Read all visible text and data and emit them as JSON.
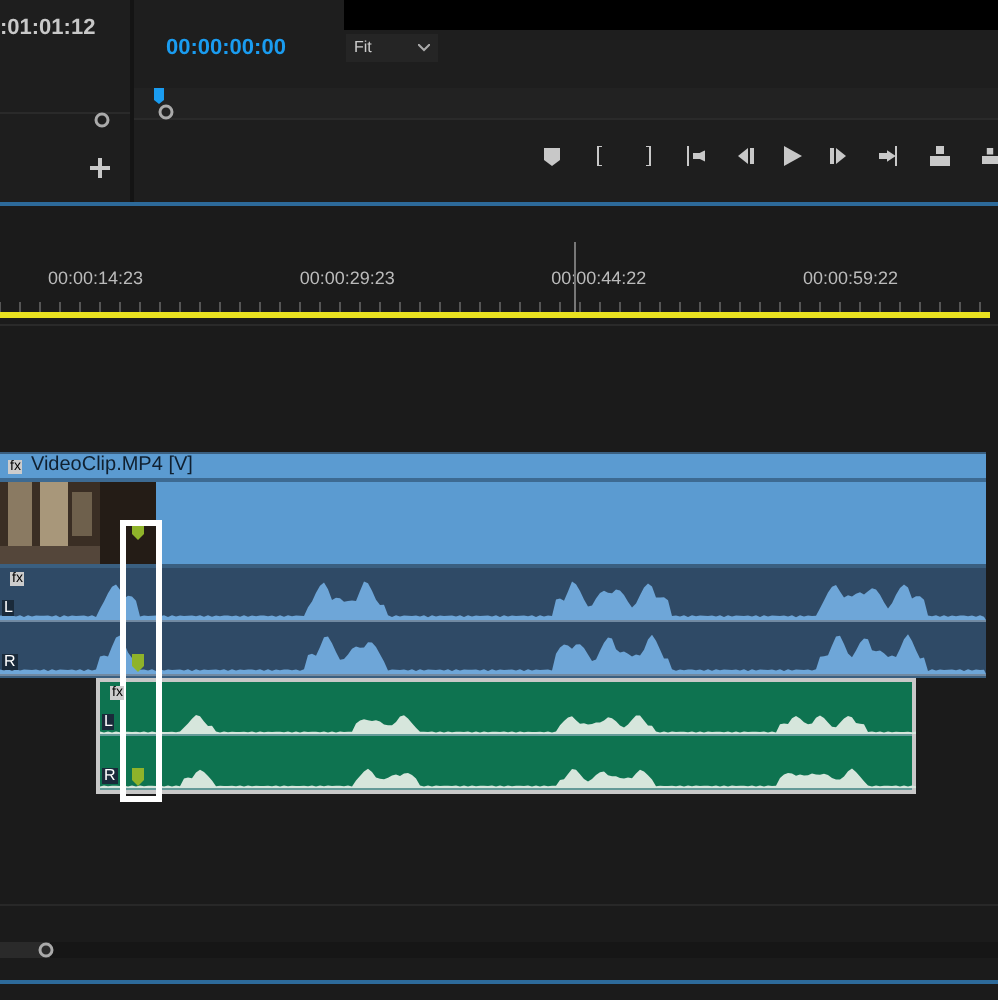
{
  "source_panel": {
    "timecode": ":01:01:12"
  },
  "program_monitor": {
    "timecode": "00:00:00:00",
    "zoom": "Fit"
  },
  "timeline": {
    "ruler_labels": [
      "00:00:14:23",
      "00:00:29:23",
      "00:00:44:22",
      "00:00:59:22"
    ],
    "clips": [
      {
        "kind": "video",
        "name": "VideoClip.MP4 [V]",
        "badge": "fx"
      },
      {
        "kind": "audio",
        "color": "#2f4a66",
        "badge": "fx",
        "channels": [
          "L",
          "R"
        ]
      },
      {
        "kind": "audio",
        "color": "#0e7350",
        "badge": "fx",
        "channels": [
          "L",
          "R"
        ]
      }
    ]
  }
}
